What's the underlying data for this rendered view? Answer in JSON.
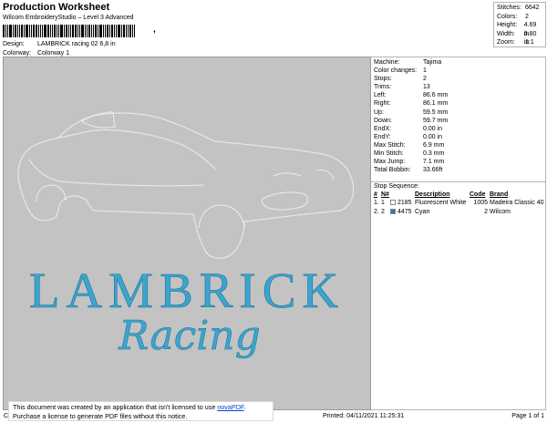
{
  "header": {
    "title": "Production Worksheet",
    "software": "Wilcom EmbroideryStudio – Level 3 Advanced",
    "barcode_suffix": ",",
    "design_label": "Design:",
    "design_value": "LAMBRICK racing 02 6,8 in",
    "colorway_label": "Colorway:",
    "colorway_value": "Colorway 1"
  },
  "stats": [
    {
      "label": "Stitches:",
      "value": "6642"
    },
    {
      "label": "Colors:",
      "value": "2"
    },
    {
      "label": "Height:",
      "value": "4.69 in"
    },
    {
      "label": "Width:",
      "value": "6.80 in"
    },
    {
      "label": "Zoom:",
      "value": "1:1"
    }
  ],
  "design_preview": {
    "line1": "LAMBRICK",
    "line2": "Racing",
    "thread_color": "#3aa6cf",
    "outline_color": "#ececec",
    "background": "#c3c3c3"
  },
  "machine_info": [
    {
      "label": "Machine:",
      "value": "Tajima"
    },
    {
      "label": "Color changes:",
      "value": "1"
    },
    {
      "label": "Stops:",
      "value": "2"
    },
    {
      "label": "Trims:",
      "value": "13"
    },
    {
      "label": "Left:",
      "value": "86.6 mm"
    },
    {
      "label": "Right:",
      "value": "86.1 mm"
    },
    {
      "label": "Up:",
      "value": "59.5 mm"
    },
    {
      "label": "Down:",
      "value": "59.7 mm"
    },
    {
      "label": "EndX:",
      "value": "0.00 in"
    },
    {
      "label": "EndY:",
      "value": "0.00 in"
    },
    {
      "label": "Max Stitch:",
      "value": "6.9 mm"
    },
    {
      "label": "Min Stitch:",
      "value": "0.3 mm"
    },
    {
      "label": "Max Jump:",
      "value": "7.1 mm"
    },
    {
      "label": "Total Bobbin:",
      "value": "33.66ft"
    }
  ],
  "stop_sequence": {
    "title": "Stop Sequence:",
    "columns": [
      "#",
      "N#",
      "",
      "Description",
      "Code",
      "Brand"
    ],
    "rows": [
      {
        "num": "1.",
        "n": "1",
        "swatch": "#ffffff",
        "code_left": "2185",
        "description": "Fluorescent White",
        "code": "1005",
        "brand": "Madeira Classic 40"
      },
      {
        "num": "2.",
        "n": "2",
        "swatch": "#1a7fc1",
        "code_left": "4475",
        "description": "Cyan",
        "code": "2",
        "brand": "Wilcom"
      }
    ]
  },
  "notice": {
    "line1_prefix": "This document was created by an application that isn't licensed to use ",
    "link": "novaPDF",
    "line1_suffix": ".",
    "line2": "Purchase a license to generate PDF files without this notice."
  },
  "footer": {
    "left": "Cr",
    "printed": "Printed: 04/11/2021 11:25:31",
    "page": "Page 1 of 1"
  }
}
